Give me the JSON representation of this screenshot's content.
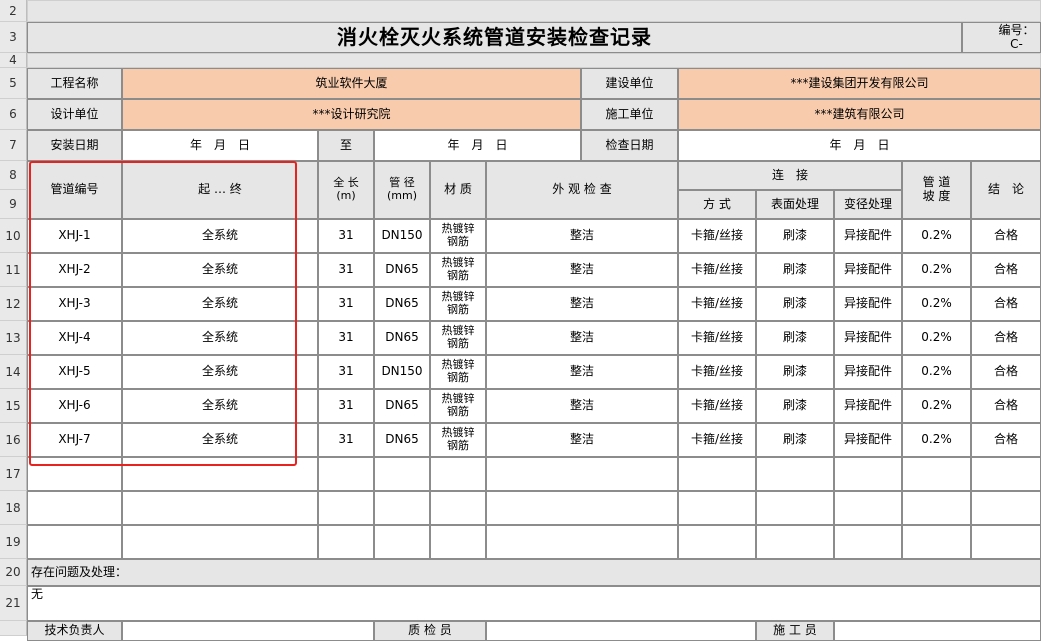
{
  "row_numbers": [
    "2",
    "3",
    "4",
    "5",
    "6",
    "7",
    "8",
    "9",
    "10",
    "11",
    "12",
    "13",
    "14",
    "15",
    "16",
    "17",
    "18",
    "19",
    "20",
    "21"
  ],
  "title": "消火栓灭火系统管道安装检查记录",
  "code_label": "编号：C-",
  "project_name_label": "工程名称",
  "project_name": "筑业软件大厦",
  "builder_label": "建设单位",
  "builder": "***建设集团开发有限公司",
  "designer_label": "设计单位",
  "designer": "***设计研究院",
  "contractor_label": "施工单位",
  "contractor": "***建筑有限公司",
  "install_date_label": "安装日期",
  "install_date_from": "年　月　日",
  "to_label": "至",
  "install_date_to": "年　月　日",
  "check_date_label": "检查日期",
  "check_date": "年　月　日",
  "headers": {
    "pipe_no": "管道编号",
    "range": "起 … 终",
    "length": "全 长\n(m)",
    "diameter": "管 径\n(mm)",
    "material": "材 质",
    "appearance": "外 观 检 查",
    "connection": "连　接",
    "method": "方 式",
    "surface": "表面处理",
    "reducer": "变径处理",
    "slope": "管 道\n坡 度",
    "conclusion": "结　论"
  },
  "rows": [
    {
      "no": "XHJ-1",
      "range": "全系统",
      "length": "31",
      "diameter": "DN150",
      "material": "热镀锌\n钢筋",
      "appearance": "整洁",
      "method": "卡箍/丝接",
      "surface": "刷漆",
      "reducer": "异接配件",
      "slope": "0.2%",
      "conclusion": "合格"
    },
    {
      "no": "XHJ-2",
      "range": "全系统",
      "length": "31",
      "diameter": "DN65",
      "material": "热镀锌\n钢筋",
      "appearance": "整洁",
      "method": "卡箍/丝接",
      "surface": "刷漆",
      "reducer": "异接配件",
      "slope": "0.2%",
      "conclusion": "合格"
    },
    {
      "no": "XHJ-3",
      "range": "全系统",
      "length": "31",
      "diameter": "DN65",
      "material": "热镀锌\n钢筋",
      "appearance": "整洁",
      "method": "卡箍/丝接",
      "surface": "刷漆",
      "reducer": "异接配件",
      "slope": "0.2%",
      "conclusion": "合格"
    },
    {
      "no": "XHJ-4",
      "range": "全系统",
      "length": "31",
      "diameter": "DN65",
      "material": "热镀锌\n钢筋",
      "appearance": "整洁",
      "method": "卡箍/丝接",
      "surface": "刷漆",
      "reducer": "异接配件",
      "slope": "0.2%",
      "conclusion": "合格"
    },
    {
      "no": "XHJ-5",
      "range": "全系统",
      "length": "31",
      "diameter": "DN150",
      "material": "热镀锌\n钢筋",
      "appearance": "整洁",
      "method": "卡箍/丝接",
      "surface": "刷漆",
      "reducer": "异接配件",
      "slope": "0.2%",
      "conclusion": "合格"
    },
    {
      "no": "XHJ-6",
      "range": "全系统",
      "length": "31",
      "diameter": "DN65",
      "material": "热镀锌\n钢筋",
      "appearance": "整洁",
      "method": "卡箍/丝接",
      "surface": "刷漆",
      "reducer": "异接配件",
      "slope": "0.2%",
      "conclusion": "合格"
    },
    {
      "no": "XHJ-7",
      "range": "全系统",
      "length": "31",
      "diameter": "DN65",
      "material": "热镀锌\n钢筋",
      "appearance": "整洁",
      "method": "卡箍/丝接",
      "surface": "刷漆",
      "reducer": "异接配件",
      "slope": "0.2%",
      "conclusion": "合格"
    }
  ],
  "issues_label": "存在问题及处理：",
  "issues_value": "无",
  "footer": {
    "tech_lead": "技术负责人",
    "qc": "质 检 员",
    "foreman": "施 工 员"
  }
}
